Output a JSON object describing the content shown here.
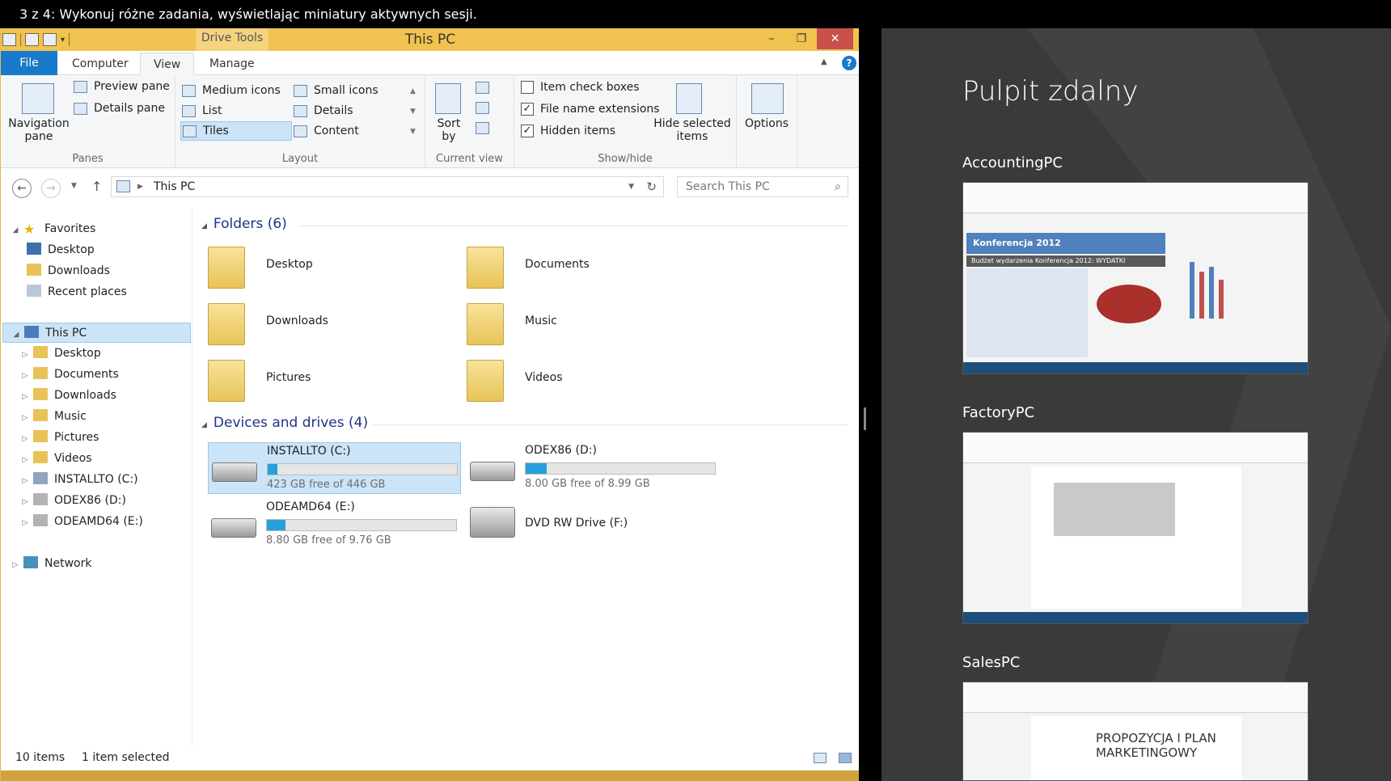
{
  "banner": {
    "text": "3 z 4: Wykonuj różne zadania, wyświetlając miniatury aktywnych sesji."
  },
  "window": {
    "title": "This PC",
    "context_tab": "Drive Tools",
    "controls": {
      "minimize": "–",
      "restore": "❐",
      "close": "✕"
    }
  },
  "tabs": {
    "file": "File",
    "computer": "Computer",
    "view": "View",
    "manage": "Manage",
    "help": "?"
  },
  "ribbon": {
    "panes": {
      "navigation_pane": "Navigation pane",
      "preview_pane": "Preview pane",
      "details_pane": "Details pane",
      "label": "Panes"
    },
    "layout": {
      "medium_icons": "Medium icons",
      "small_icons": "Small icons",
      "list": "List",
      "details": "Details",
      "tiles": "Tiles",
      "content": "Content",
      "label": "Layout"
    },
    "current_view": {
      "sort_by": "Sort by",
      "label": "Current view"
    },
    "show_hide": {
      "item_check_boxes": {
        "label": "Item check boxes",
        "checked": false
      },
      "file_name_extensions": {
        "label": "File name extensions",
        "checked": true
      },
      "hidden_items": {
        "label": "Hidden items",
        "checked": true
      },
      "hide_selected": "Hide selected items",
      "label": "Show/hide"
    },
    "options": "Options"
  },
  "address": {
    "path": "This PC",
    "search_placeholder": "Search This PC"
  },
  "nav_pane": {
    "favorites": {
      "label": "Favorites",
      "items": [
        "Desktop",
        "Downloads",
        "Recent places"
      ]
    },
    "this_pc": {
      "label": "This PC",
      "items": [
        "Desktop",
        "Documents",
        "Downloads",
        "Music",
        "Pictures",
        "Videos",
        "INSTALLTO (C:)",
        "ODEX86 (D:)",
        "ODEAMD64 (E:)"
      ]
    },
    "network": "Network"
  },
  "content": {
    "folders_header": "Folders (6)",
    "folders": [
      "Desktop",
      "Documents",
      "Downloads",
      "Music",
      "Pictures",
      "Videos"
    ],
    "drives_header": "Devices and drives (4)",
    "drives": [
      {
        "name": "INSTALLTO (C:)",
        "free": "423 GB free of 446 GB",
        "used_fraction": 0.05
      },
      {
        "name": "ODEX86 (D:)",
        "free": "8.00 GB free of 8.99 GB",
        "used_fraction": 0.11
      },
      {
        "name": "ODEAMD64 (E:)",
        "free": "8.80 GB free of 9.76 GB",
        "used_fraction": 0.1
      },
      {
        "name": "DVD RW Drive (F:)"
      }
    ]
  },
  "status": {
    "items": "10 items",
    "selected": "1 item selected"
  },
  "remote": {
    "title": "Pulpit zdalny",
    "sessions": [
      {
        "name": "AccountingPC",
        "preview_heading": "Konferencja 2012",
        "preview_subheading": "Budżet wydarzenia Konferencja 2012: WYDATKI"
      },
      {
        "name": "FactoryPC"
      },
      {
        "name": "SalesPC",
        "preview_heading": "PROPOZYCJA I PLAN MARKETINGOWY"
      }
    ]
  },
  "colors": {
    "accent": "#1979ca",
    "titlebar": "#f0c24f",
    "drive_bar": "#26a0da",
    "selection": "#cce4f7",
    "remote_bg": "#3a3a3a"
  }
}
